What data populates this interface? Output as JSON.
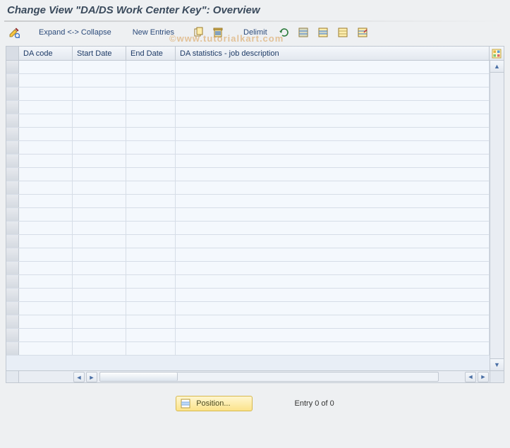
{
  "title": "Change View \"DA/DS Work Center Key\": Overview",
  "toolbar": {
    "expand_collapse": "Expand <-> Collapse",
    "new_entries": "New Entries",
    "delimit": "Delimit"
  },
  "columns": {
    "c1": "DA code",
    "c2": "Start Date",
    "c3": "End Date",
    "c4": "DA statistics - job description"
  },
  "rows_count": 22,
  "footer": {
    "position_btn": "Position...",
    "entry_text": "Entry 0 of 0"
  },
  "watermark": "©www.tutorialkart.com"
}
